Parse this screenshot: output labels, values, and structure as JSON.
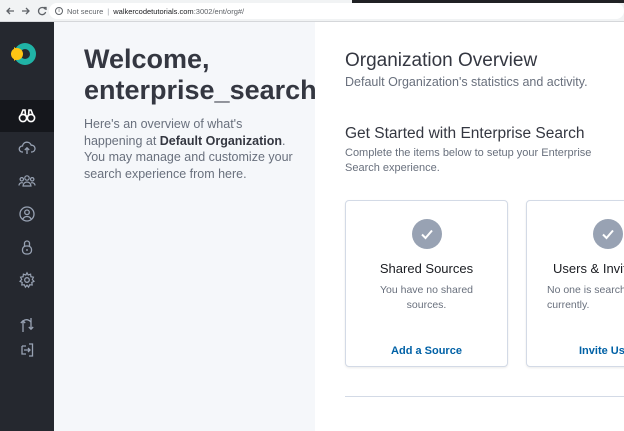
{
  "browser": {
    "back_icon": "arrow-left-icon",
    "forward_icon": "arrow-right-icon",
    "reload_icon": "reload-icon",
    "security_label": "Not secure",
    "url_host": "walkercodetutorials.com",
    "url_path": ":3002/ent/org#/"
  },
  "sidebar": {
    "items": [
      {
        "icon": "binoculars-icon",
        "active": true
      },
      {
        "icon": "cloud-upload-icon",
        "active": false
      },
      {
        "icon": "users-group-icon",
        "active": false
      },
      {
        "icon": "user-circle-icon",
        "active": false
      },
      {
        "icon": "lock-icon",
        "active": false
      },
      {
        "icon": "gear-icon",
        "active": false
      },
      {
        "icon": "switch-arrows-icon",
        "active": false
      },
      {
        "icon": "logout-icon",
        "active": false
      }
    ]
  },
  "welcome": {
    "title": "Welcome, enterprise_search",
    "desc_before": "Here's an overview of what's happening at ",
    "org_name": "Default Organization",
    "desc_after": ". You may manage and customize your search experience from here."
  },
  "overview": {
    "title": "Organization Overview",
    "subtitle": "Default Organization's statistics and activity."
  },
  "get_started": {
    "title": "Get Started with Enterprise Search",
    "subtitle": "Complete the items below to setup your Enterprise Search experience."
  },
  "cards": [
    {
      "title": "Shared Sources",
      "desc": "You have no shared sources.",
      "link": "Add a Source"
    },
    {
      "title": "Users & Invitations",
      "desc": "No one is searching with you currently.",
      "link": "Invite Users"
    }
  ],
  "colors": {
    "sidebar_bg": "#25282f",
    "sidebar_active": "#15171c",
    "logo_teal": "#20b3a6",
    "logo_yellow": "#fec514",
    "link_blue": "#0061a6",
    "check_gray": "#98a2b3"
  }
}
